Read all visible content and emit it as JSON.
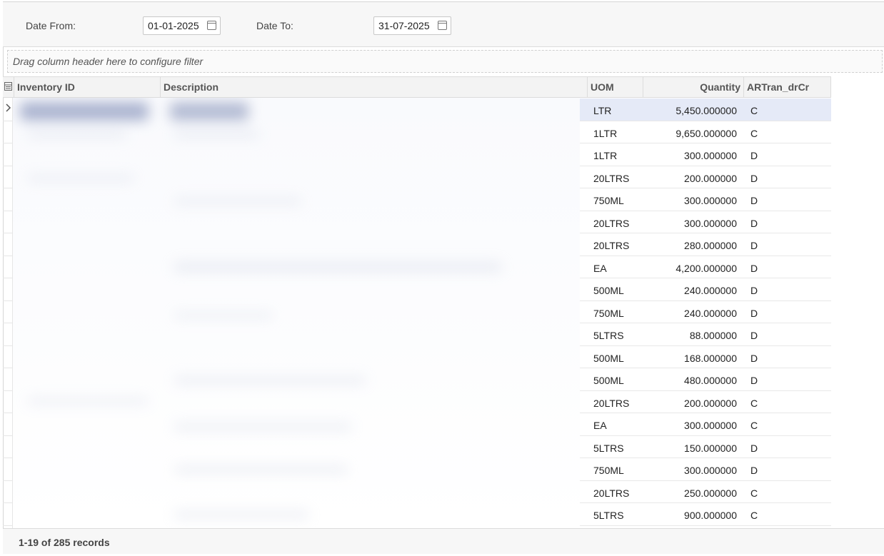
{
  "filters": {
    "date_from_label": "Date From:",
    "date_from_value": "01-01-2025",
    "date_to_label": "Date To:",
    "date_to_value": "31-07-2025"
  },
  "group_panel_hint": "Drag column header here to configure filter",
  "columns": {
    "inventory_id": "Inventory ID",
    "description": "Description",
    "uom": "UOM",
    "quantity": "Quantity",
    "artran_drcr": "ARTran_drCr"
  },
  "rows": [
    {
      "uom": "LTR",
      "quantity": "5,450.000000",
      "drcr": "C"
    },
    {
      "uom": "1LTR",
      "quantity": "9,650.000000",
      "drcr": "C"
    },
    {
      "uom": "1LTR",
      "quantity": "300.000000",
      "drcr": "D"
    },
    {
      "uom": "20LTRS",
      "quantity": "200.000000",
      "drcr": "D"
    },
    {
      "uom": "750ML",
      "quantity": "300.000000",
      "drcr": "D"
    },
    {
      "uom": "20LTRS",
      "quantity": "300.000000",
      "drcr": "D"
    },
    {
      "uom": "20LTRS",
      "quantity": "280.000000",
      "drcr": "D"
    },
    {
      "uom": "EA",
      "quantity": "4,200.000000",
      "drcr": "D"
    },
    {
      "uom": "500ML",
      "quantity": "240.000000",
      "drcr": "D"
    },
    {
      "uom": "750ML",
      "quantity": "240.000000",
      "drcr": "D"
    },
    {
      "uom": "5LTRS",
      "quantity": "88.000000",
      "drcr": "D"
    },
    {
      "uom": "500ML",
      "quantity": "168.000000",
      "drcr": "D"
    },
    {
      "uom": "500ML",
      "quantity": "480.000000",
      "drcr": "D"
    },
    {
      "uom": "20LTRS",
      "quantity": "200.000000",
      "drcr": "C"
    },
    {
      "uom": "EA",
      "quantity": "300.000000",
      "drcr": "C"
    },
    {
      "uom": "5LTRS",
      "quantity": "150.000000",
      "drcr": "D"
    },
    {
      "uom": "750ML",
      "quantity": "300.000000",
      "drcr": "D"
    },
    {
      "uom": "20LTRS",
      "quantity": "250.000000",
      "drcr": "C"
    },
    {
      "uom": "5LTRS",
      "quantity": "900.000000",
      "drcr": "C"
    }
  ],
  "footer_text": "1-19 of 285 records",
  "icons": {
    "calendar": "calendar-icon",
    "column_chooser": "column-chooser-icon",
    "row_indicator": "chevron-right-icon"
  },
  "colors": {
    "selected_row": "#e5eaf7",
    "header_bg": "#f3f3f3"
  }
}
